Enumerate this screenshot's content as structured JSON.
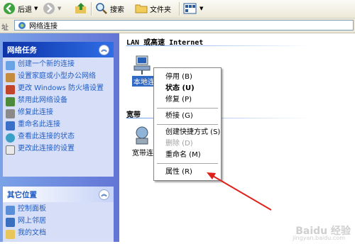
{
  "toolbar": {
    "back_label": "后退",
    "search_label": "搜索",
    "folders_label": "文件夹"
  },
  "address": {
    "label": "址",
    "value": "网络连接"
  },
  "sidebar": {
    "network_tasks": {
      "title": "网络任务",
      "items": [
        {
          "label": "创建一个新的连接"
        },
        {
          "label": "设置家庭或小型办公网络"
        },
        {
          "label": "更改 Windows 防火墙设置"
        },
        {
          "label": "禁用此网络设备"
        },
        {
          "label": "修复此连接"
        },
        {
          "label": "重命名此连接"
        },
        {
          "label": "查看此连接的状态"
        },
        {
          "label": "更改此连接的设置"
        }
      ]
    },
    "other_places": {
      "title": "其它位置",
      "items": [
        {
          "label": "控制面板"
        },
        {
          "label": "网上邻居"
        },
        {
          "label": "我的文档"
        }
      ]
    }
  },
  "main": {
    "lan_header": "LAN 或高速 Internet",
    "lan_item_label": "本地连接",
    "broadband_header": "宽带",
    "broadband_item_label": "宽带连接"
  },
  "context_menu": {
    "items": [
      {
        "label": "停用 (B)"
      },
      {
        "label": "状态 (U)"
      },
      {
        "label": "修复 (P)"
      },
      {
        "label": "桥接 (G)"
      },
      {
        "label": "创建快捷方式 (S)"
      },
      {
        "label": "删除 (D)"
      },
      {
        "label": "重命名 (M)"
      },
      {
        "label": "属性 (R)"
      }
    ]
  },
  "watermark": {
    "text": "Baidu 经验",
    "url": "jingyan.baidu.com"
  }
}
